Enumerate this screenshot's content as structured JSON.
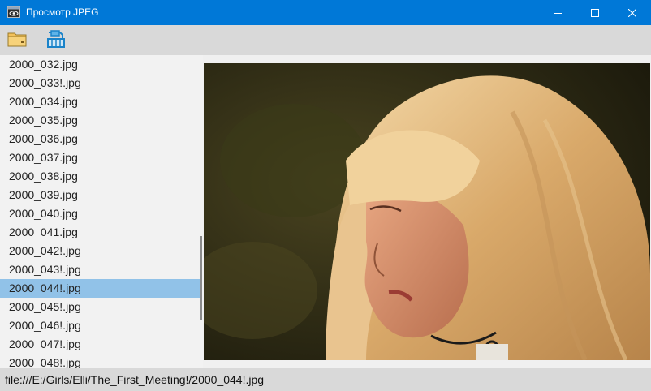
{
  "window": {
    "title": "Просмотр JPEG"
  },
  "toolbar": {
    "open_icon": "folder-open-icon",
    "save_icon": "save-icon"
  },
  "file_list": {
    "items": [
      "2000_032.jpg",
      "2000_033!.jpg",
      "2000_034.jpg",
      "2000_035.jpg",
      "2000_036.jpg",
      "2000_037.jpg",
      "2000_038.jpg",
      "2000_039.jpg",
      "2000_040.jpg",
      "2000_041.jpg",
      "2000_042!.jpg",
      "2000_043!.jpg",
      "2000_044!.jpg",
      "2000_045!.jpg",
      "2000_046!.jpg",
      "2000_047!.jpg",
      "2000_048!.jpg"
    ],
    "selected": "2000_044!.jpg"
  },
  "status": {
    "path": "file:///E:/Girls/Elli/The_First_Meeting!/2000_044!.jpg"
  },
  "colors": {
    "titlebar": "#0078d7",
    "selection": "#91c2e8",
    "toolbar": "#d9d9d9"
  }
}
